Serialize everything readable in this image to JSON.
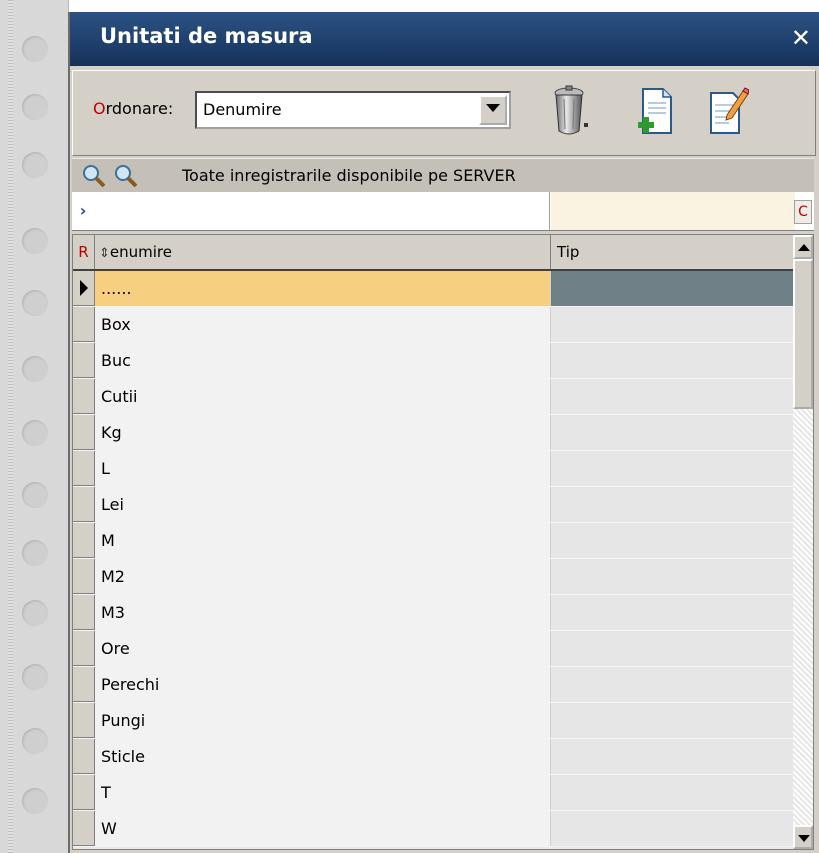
{
  "window": {
    "title": "Unitati de masura",
    "close_glyph": "✕"
  },
  "toolbar": {
    "order_label_accel": "O",
    "order_label_rest": "rdonare:",
    "order_value": "Denumire",
    "buttons": [
      "trash-icon",
      "add-document-icon",
      "edit-document-icon"
    ]
  },
  "filter_bar": {
    "text": "Toate inregistrarile disponibile pe SERVER"
  },
  "filter_row": {
    "arrow": "›",
    "c_label": "C"
  },
  "grid": {
    "r_label": "R",
    "sort_glyph": "⇕",
    "col_denumire": "enumire",
    "col_tip": "Tip",
    "rows": [
      {
        "denumire": "......",
        "tip": ""
      },
      {
        "denumire": "Box",
        "tip": ""
      },
      {
        "denumire": "Buc",
        "tip": ""
      },
      {
        "denumire": "Cutii",
        "tip": ""
      },
      {
        "denumire": "Kg",
        "tip": ""
      },
      {
        "denumire": "L",
        "tip": ""
      },
      {
        "denumire": "Lei",
        "tip": ""
      },
      {
        "denumire": "M",
        "tip": ""
      },
      {
        "denumire": "M2",
        "tip": ""
      },
      {
        "denumire": "M3",
        "tip": ""
      },
      {
        "denumire": "Ore",
        "tip": ""
      },
      {
        "denumire": "Perechi",
        "tip": ""
      },
      {
        "denumire": "Pungi",
        "tip": ""
      },
      {
        "denumire": "Sticle",
        "tip": ""
      },
      {
        "denumire": "T",
        "tip": ""
      },
      {
        "denumire": "W",
        "tip": ""
      }
    ]
  }
}
